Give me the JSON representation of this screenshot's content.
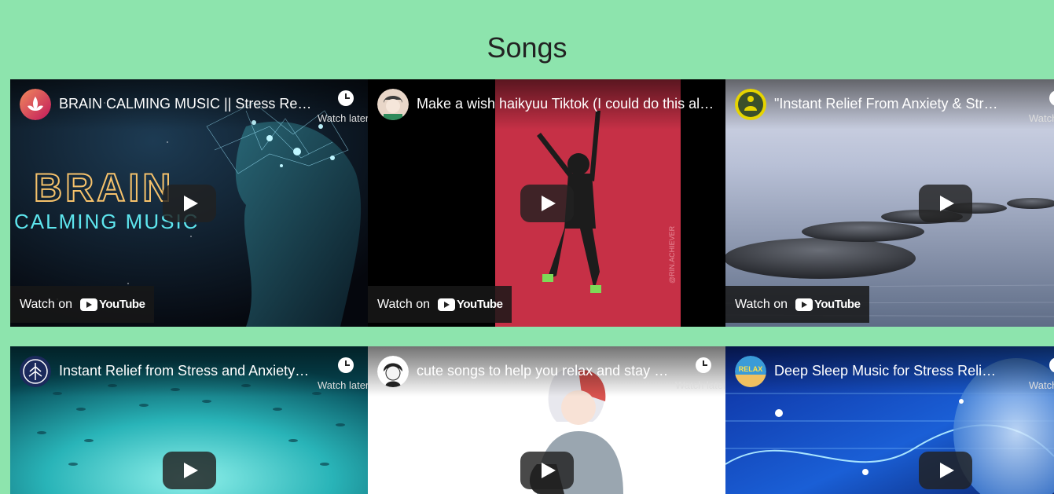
{
  "page": {
    "title": "Songs"
  },
  "common": {
    "watch_later": "Watch later",
    "watch_on": "Watch on",
    "youtube": "YouTube"
  },
  "videos": [
    {
      "title": "BRAIN CALMING MUSIC || Stress Relief Music",
      "thumb_text_1": "BRAIN",
      "thumb_text_2": "CALMING MUSIC"
    },
    {
      "title": "Make a wish haikyuu Tiktok (I could do this all day)",
      "thumb_watermark": "@RIN.ACHIEVER"
    },
    {
      "title": "\"Instant Relief From Anxiety & Stress\" Peaceful Music"
    },
    {
      "title": "Instant Relief from Stress and Anxiety | Relaxing Music"
    },
    {
      "title": "cute songs to help you relax and stay calm"
    },
    {
      "title": "Deep Sleep Music for Stress Relief: Healing Music",
      "avatar_text": "RELAX"
    }
  ]
}
